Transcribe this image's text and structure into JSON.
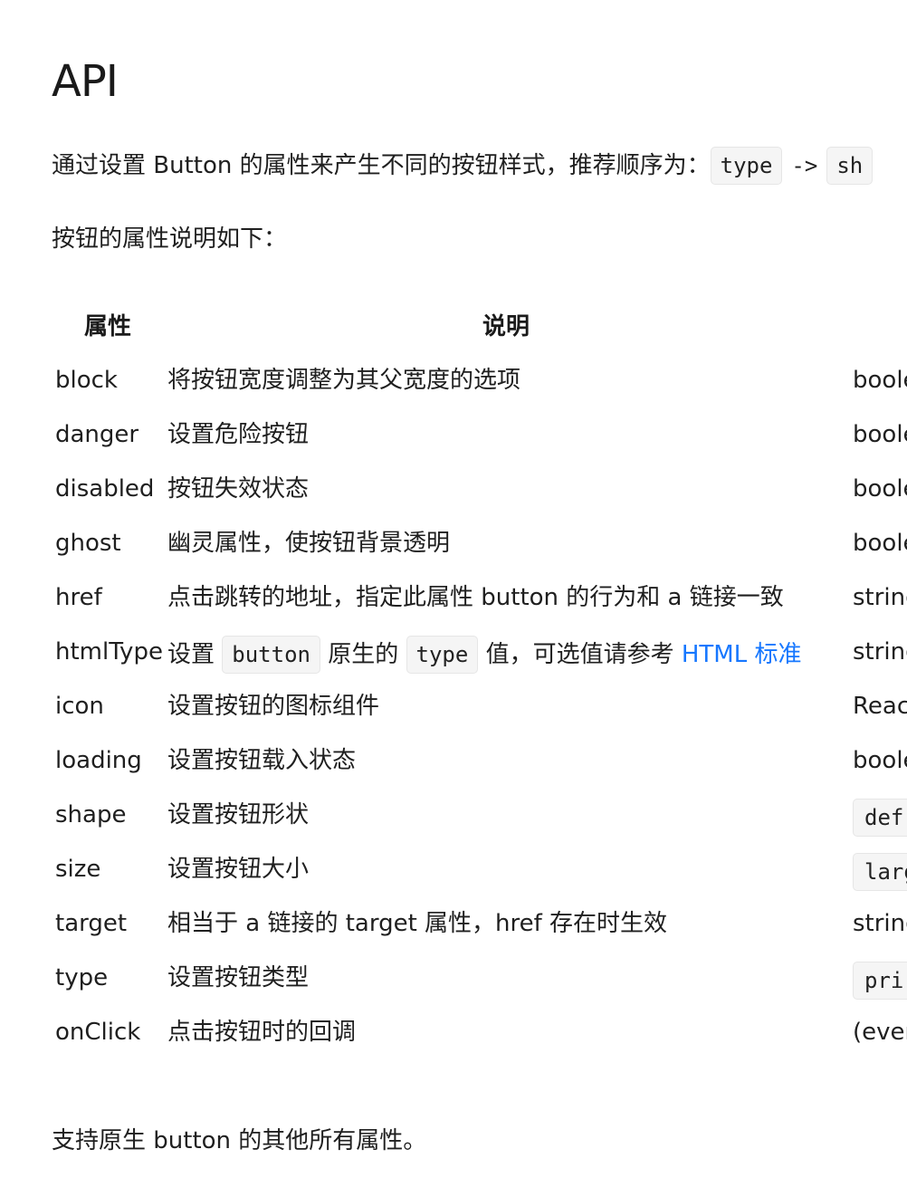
{
  "title": "API",
  "intro": {
    "text": "通过设置 Button 的属性来产生不同的按钮样式，推荐顺序为：",
    "code1": "type",
    "arrow": "->",
    "code2": "sh"
  },
  "props_intro": "按钮的属性说明如下：",
  "table": {
    "headers": {
      "property": "属性",
      "description": "说明"
    },
    "rows": [
      {
        "prop": "block",
        "desc": "将按钮宽度调整为其父宽度的选项",
        "type": "boole",
        "type_code": false
      },
      {
        "prop": "danger",
        "desc": "设置危险按钮",
        "type": "boole",
        "type_code": false
      },
      {
        "prop": "disabled",
        "desc": "按钮失效状态",
        "type": "boole",
        "type_code": false
      },
      {
        "prop": "ghost",
        "desc": "幽灵属性，使按钮背景透明",
        "type": "boole",
        "type_code": false
      },
      {
        "prop": "href",
        "desc": "点击跳转的地址，指定此属性 button 的行为和 a 链接一致",
        "type": "string",
        "type_code": false
      },
      {
        "prop": "icon",
        "desc": "设置按钮的图标组件",
        "type": "Reac",
        "type_code": false
      },
      {
        "prop": "loading",
        "desc": "设置按钮载入状态",
        "type": "boole",
        "type_code": false
      },
      {
        "prop": "shape",
        "desc": "设置按钮形状",
        "type": "def",
        "type_code": true
      },
      {
        "prop": "size",
        "desc": "设置按钮大小",
        "type": "larg",
        "type_code": true
      },
      {
        "prop": "target",
        "desc": "相当于 a 链接的 target 属性，href 存在时生效",
        "type": "string",
        "type_code": false
      },
      {
        "prop": "type",
        "desc": "设置按钮类型",
        "type": "pri",
        "type_code": true
      },
      {
        "prop": "onClick",
        "desc": "点击按钮时的回调",
        "type": "(even",
        "type_code": false
      }
    ],
    "htmltype_row": {
      "prop": "htmlType",
      "desc_1": "设置",
      "code_1": "button",
      "desc_2": "原生的",
      "code_2": "type",
      "desc_3": "值，可选值请参考",
      "link": "HTML 标准",
      "type": "string"
    }
  },
  "footer_note": "支持原生 button 的其他所有属性。",
  "colors": {
    "link": "#1677ff",
    "code_bg": "#f5f5f5"
  }
}
